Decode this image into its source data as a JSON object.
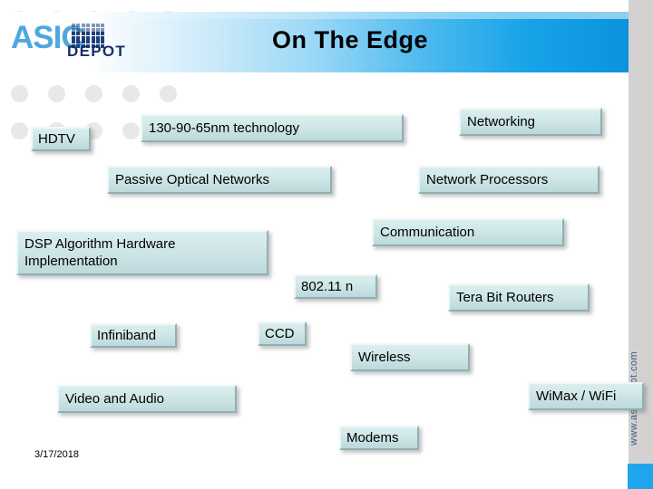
{
  "slide": {
    "title": "On The Edge",
    "date": "3/17/2018",
    "site_url": "www.asicdepot.com",
    "accent_color": "#1fa5ec",
    "node_fill": "#cfe6e7",
    "logo": {
      "brand": "ASIC",
      "sub_brand": "DEPOT"
    },
    "nodes": [
      {
        "label": "HDTV"
      },
      {
        "label": "130-90-65nm technology"
      },
      {
        "label": "Networking"
      },
      {
        "label": "Passive Optical Networks"
      },
      {
        "label": "Network Processors"
      },
      {
        "label": "Communication"
      },
      {
        "label": "DSP Algorithm Hardware\nImplementation"
      },
      {
        "label": "802.11 n"
      },
      {
        "label": "Tera Bit Routers"
      },
      {
        "label": "Infiniband"
      },
      {
        "label": "CCD"
      },
      {
        "label": "Wireless"
      },
      {
        "label": "Video and Audio"
      },
      {
        "label": "WiMax / WiFi"
      },
      {
        "label": "Modems"
      }
    ]
  }
}
